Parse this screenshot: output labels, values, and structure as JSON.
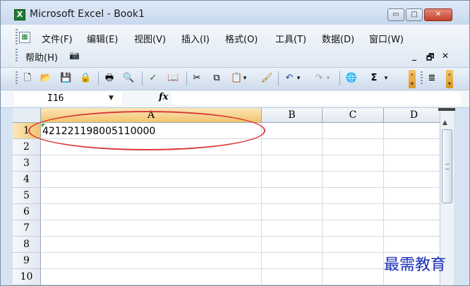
{
  "window": {
    "title": "Microsoft Excel - Book1",
    "app_icon_glyph": "X"
  },
  "window_controls": {
    "minimize": "▭",
    "maximize": "□",
    "close": "✕"
  },
  "menu": {
    "items": [
      "文件(F)",
      "编辑(E)",
      "视图(V)",
      "插入(I)",
      "格式(O)",
      "工具(T)",
      "数据(D)",
      "窗口(W)"
    ],
    "row2": [
      "帮助(H)"
    ],
    "camera_glyph": "📷",
    "mdi_min": "_",
    "mdi_restore": "🗗",
    "mdi_close": "✕"
  },
  "toolbar": {
    "sigma_label": "Σ",
    "dropdown_glyph": "▾"
  },
  "formula_bar": {
    "name_box": "I16",
    "fx_label": "fx",
    "formula_value": ""
  },
  "sheet": {
    "columns": [
      "A",
      "B",
      "C",
      "D"
    ],
    "selected_column": "A",
    "rows": [
      "1",
      "2",
      "3",
      "4",
      "5",
      "6",
      "7",
      "8",
      "9",
      "10"
    ],
    "selected_row": "1",
    "cells": {
      "A1": "421221198005110000"
    }
  },
  "annotation": {
    "color": "#d93a3a",
    "shape": "ellipse around cell A1"
  },
  "watermark": {
    "text": "最需教育",
    "color": "#1a2fb5"
  },
  "colors": {
    "title_bg": "#c7d8ee",
    "header_sel": "#f2c46e",
    "excel_green": "#1e7a33"
  }
}
